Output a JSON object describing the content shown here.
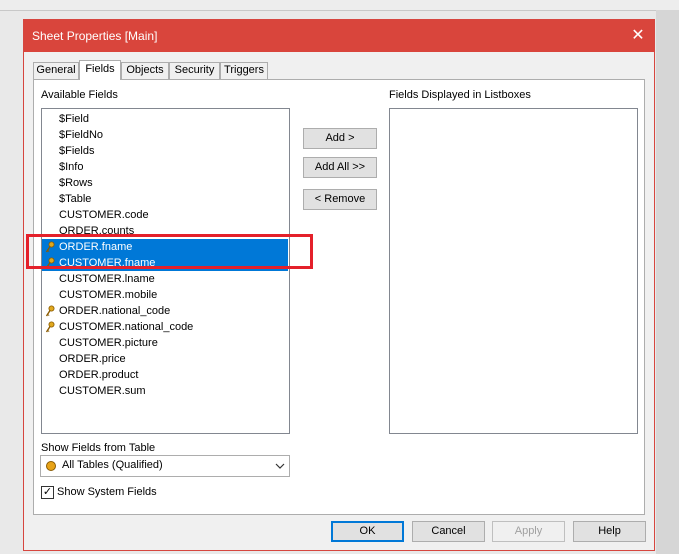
{
  "dialog": {
    "title": "Sheet Properties [Main]",
    "close_glyph": "✕"
  },
  "tabs": [
    {
      "label": "General"
    },
    {
      "label": "Fields",
      "active": true
    },
    {
      "label": "Objects"
    },
    {
      "label": "Security"
    },
    {
      "label": "Triggers"
    }
  ],
  "available": {
    "label": "Available Fields",
    "items": [
      {
        "label": "$Field"
      },
      {
        "label": "$FieldNo"
      },
      {
        "label": "$Fields"
      },
      {
        "label": "$Info"
      },
      {
        "label": "$Rows"
      },
      {
        "label": "$Table"
      },
      {
        "label": "CUSTOMER.code"
      },
      {
        "label": "ORDER.counts"
      },
      {
        "label": "ORDER.fname",
        "key": true,
        "selected": true
      },
      {
        "label": "CUSTOMER.fname",
        "key": true,
        "selected": true
      },
      {
        "label": "CUSTOMER.lname"
      },
      {
        "label": "CUSTOMER.mobile"
      },
      {
        "label": "ORDER.national_code",
        "key": true
      },
      {
        "label": "CUSTOMER.national_code",
        "key": true
      },
      {
        "label": "CUSTOMER.picture"
      },
      {
        "label": "ORDER.price"
      },
      {
        "label": "ORDER.product"
      },
      {
        "label": "CUSTOMER.sum"
      }
    ]
  },
  "displayed": {
    "label": "Fields Displayed in Listboxes"
  },
  "buttons": {
    "add": "Add >",
    "add_all": "Add All >>",
    "remove": "< Remove"
  },
  "table_filter": {
    "label": "Show Fields from Table",
    "value": "All Tables (Qualified)"
  },
  "show_system": {
    "label": "Show System Fields",
    "checked": true
  },
  "footer": {
    "ok": "OK",
    "cancel": "Cancel",
    "apply": "Apply",
    "help": "Help"
  },
  "colors": {
    "titlebar": "#d9453c",
    "selection": "#0078d7",
    "highlight_box": "#e4202a"
  }
}
